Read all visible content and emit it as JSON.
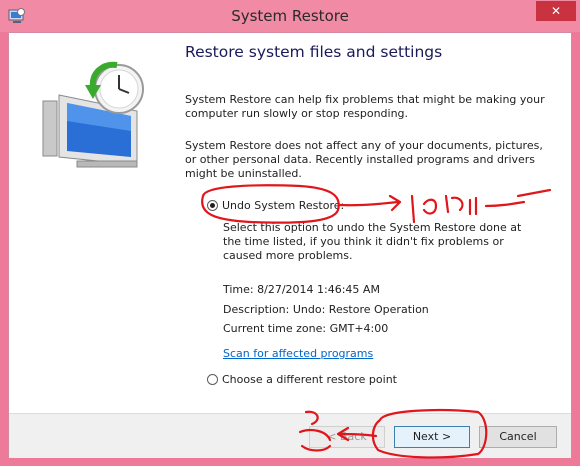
{
  "window": {
    "title": "System Restore",
    "close_label": "✕"
  },
  "content": {
    "heading": "Restore system files and settings",
    "para1": "System Restore can help fix problems that might be making your computer run slowly or stop responding.",
    "para2": "System Restore does not affect any of your documents, pictures, or other personal data. Recently installed programs and drivers might be uninstalled.",
    "options": [
      {
        "label": "Undo System Restore:",
        "checked": true
      },
      {
        "label": "Choose a different restore point",
        "checked": false
      }
    ],
    "undo_description": "Select this option to undo the System Restore done at the time listed, if you think it didn't fix problems or caused more problems.",
    "time": "Time: 8/27/2014 1:46:45 AM",
    "description": "Description: Undo: Restore Operation",
    "timezone": "Current time zone: GMT+4:00",
    "scan_link": "Scan for affected programs"
  },
  "footer": {
    "back_label": "< Back",
    "next_label": "Next >",
    "cancel_label": "Cancel"
  },
  "colors": {
    "annotation": "#e0161b",
    "link": "#0066cc"
  }
}
